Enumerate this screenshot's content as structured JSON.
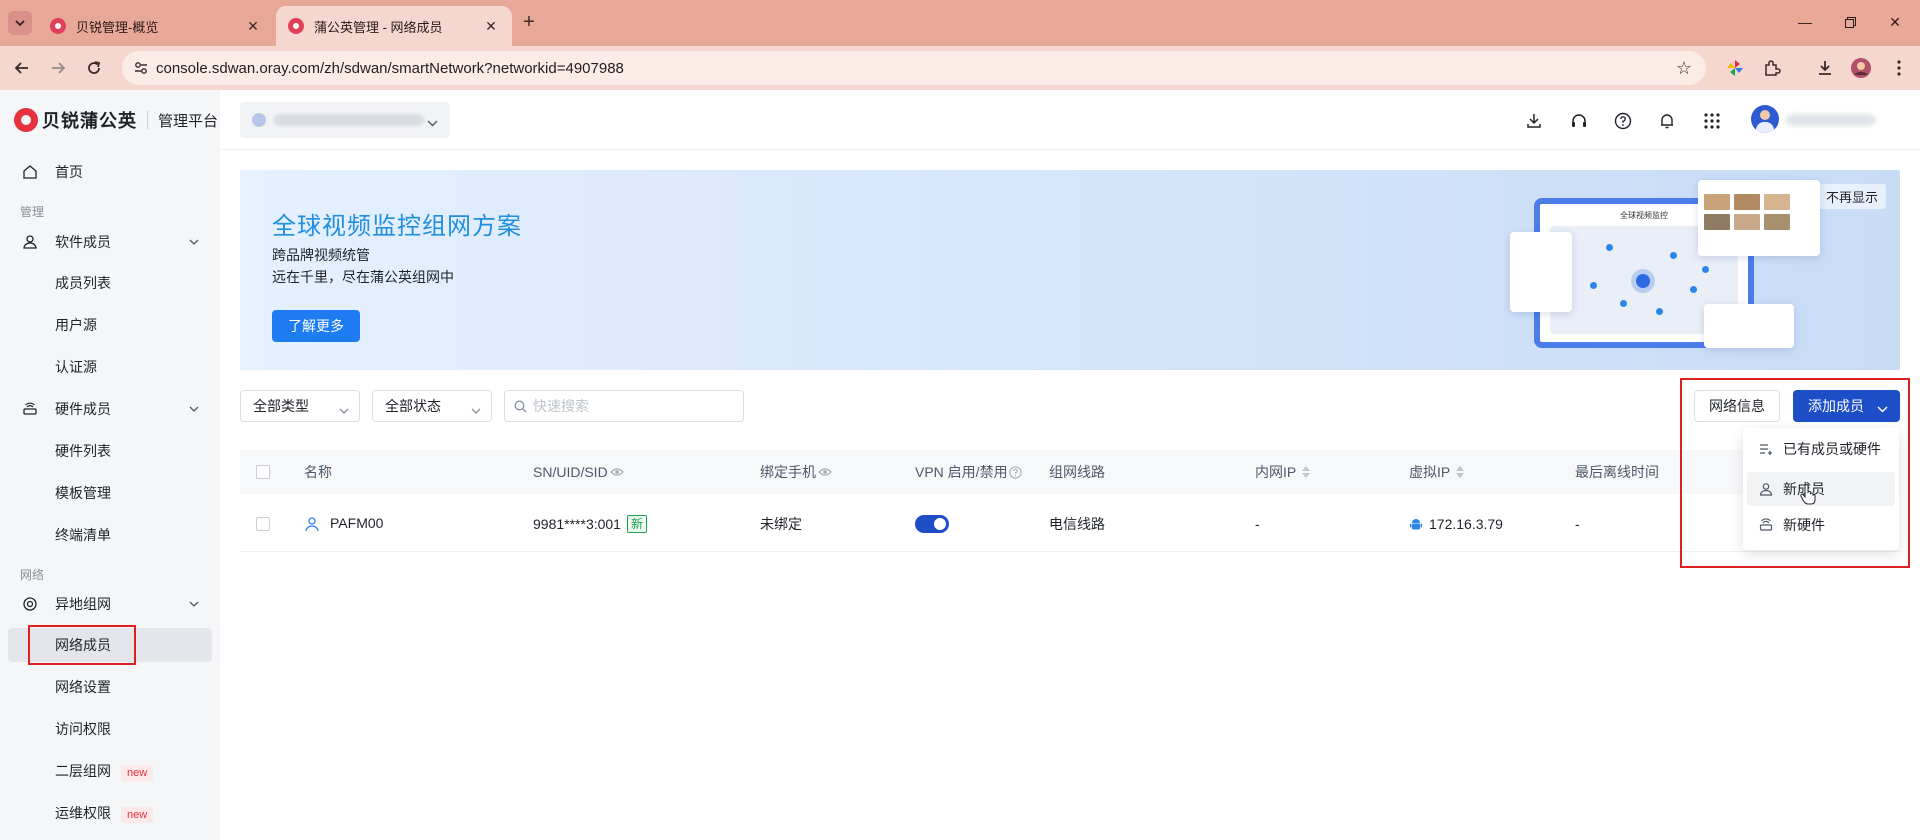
{
  "browser": {
    "tabs": [
      {
        "title": "贝锐管理-概览",
        "active": false
      },
      {
        "title": "蒲公英管理 - 网络成员",
        "active": true
      }
    ],
    "url": "console.sdwan.oray.com/zh/sdwan/smartNetwork?networkid=4907988"
  },
  "sidebar": {
    "brand": "贝锐蒲公英",
    "platform": "管理平台",
    "home": "首页",
    "group_manage": "管理",
    "software_members": "软件成员",
    "member_list": "成员列表",
    "user_source": "用户源",
    "auth_source": "认证源",
    "hardware_members": "硬件成员",
    "hardware_list": "硬件列表",
    "template_manage": "模板管理",
    "terminal_list": "终端清单",
    "group_network": "网络",
    "remote_network": "异地组网",
    "network_members": "网络成员",
    "network_settings": "网络设置",
    "access_rights": "访问权限",
    "layer2_network": "二层组网",
    "ops_rights": "运维权限",
    "badge_new": "new"
  },
  "banner": {
    "title": "全球视频监控组网方案",
    "subtitle1": "跨品牌视频统管",
    "subtitle2": "远在千里，尽在蒲公英组网中",
    "button": "了解更多",
    "hide": "不再显示",
    "illus_title": "全球视频监控"
  },
  "toolbar": {
    "type_filter": "全部类型",
    "status_filter": "全部状态",
    "search_placeholder": "快速搜索",
    "network_info": "网络信息",
    "add_member": "添加成员"
  },
  "dropdown": {
    "items": [
      "已有成员或硬件",
      "新成员",
      "新硬件"
    ]
  },
  "table": {
    "columns": [
      "名称",
      "SN/UID/SID",
      "绑定手机",
      "VPN 启用/禁用",
      "组网线路",
      "内网IP",
      "虚拟IP",
      "最后离线时间"
    ],
    "rows": [
      {
        "name": "PAFM00",
        "sn": "9981****3:001",
        "sn_tag": "新",
        "phone": "未绑定",
        "vpn_enabled": true,
        "line": "电信线路",
        "lan_ip": "-",
        "virtual_ip": "172.16.3.79",
        "last_offline": "-"
      }
    ]
  },
  "colors": {
    "primary": "#1d4ec8",
    "banner_blue": "#1d7cf2",
    "highlight_red": "#e02020",
    "tab_bar": "#e8a898"
  }
}
